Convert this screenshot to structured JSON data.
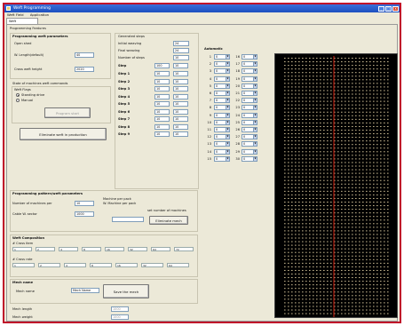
{
  "window": {
    "title": "Weft Programming",
    "minimize": "_",
    "maximize": "□",
    "close": "x"
  },
  "menu": [
    "Weft Field",
    "Application"
  ],
  "tabs": [
    "Weft Programming",
    "Programming Features"
  ],
  "section": {
    "title": "Programming Features"
  },
  "weft_params": {
    "title": "Programming weft parameters",
    "rows": [
      {
        "label": "Open shed",
        "value": ""
      },
      {
        "label": "W. Length(default)",
        "value": "40"
      },
      {
        "label": "Cross weft height",
        "value": "2020"
      }
    ]
  },
  "mode": {
    "title": "State of machines weft commands",
    "subtitle": "Weft Flags",
    "options": [
      {
        "label": "Standing drive",
        "selected": true
      },
      {
        "label": "Manual",
        "selected": false
      }
    ],
    "program_button": "Program start",
    "eliminate_button": "Eliminate weft in production"
  },
  "seq": {
    "title": "Generated steps",
    "rows": [
      {
        "label": "Initial weaving",
        "value": "24"
      },
      {
        "label": "Final weaving",
        "value": "24"
      },
      {
        "label": "Number of steps",
        "value": "10"
      }
    ],
    "header": [
      "Step",
      "100",
      "10"
    ],
    "steps": [
      {
        "label": "Step 1",
        "a": "10",
        "b": "10"
      },
      {
        "label": "Step 2",
        "a": "10",
        "b": "10"
      },
      {
        "label": "Step 3",
        "a": "10",
        "b": "10"
      },
      {
        "label": "Step 4",
        "a": "10",
        "b": "10"
      },
      {
        "label": "Step 5",
        "a": "10",
        "b": "10"
      },
      {
        "label": "Step 6",
        "a": "10",
        "b": "10"
      },
      {
        "label": "Step 7",
        "a": "10",
        "b": "10"
      },
      {
        "label": "Step 8",
        "a": "10",
        "b": "10"
      },
      {
        "label": "Step 9",
        "a": "10",
        "b": "10"
      }
    ]
  },
  "auto": {
    "title": "Automatic",
    "rows": [
      {
        "n1": "1",
        "v1": "0",
        "n2": "16",
        "v2": "0"
      },
      {
        "n1": "2",
        "v1": "0",
        "n2": "17",
        "v2": "0"
      },
      {
        "n1": "3",
        "v1": "0",
        "n2": "18",
        "v2": "0"
      },
      {
        "n1": "4",
        "v1": "0",
        "n2": "19",
        "v2": "0"
      },
      {
        "n1": "5",
        "v1": "0",
        "n2": "20",
        "v2": "0"
      },
      {
        "n1": "6",
        "v1": "0",
        "n2": "21",
        "v2": "0"
      },
      {
        "n1": "7",
        "v1": "0",
        "n2": "22",
        "v2": "0"
      },
      {
        "n1": "8",
        "v1": "0",
        "n2": "23",
        "v2": "0"
      },
      {
        "n1": "9",
        "v1": "0",
        "n2": "24",
        "v2": "0"
      },
      {
        "n1": "10",
        "v1": "0",
        "n2": "25",
        "v2": "0"
      },
      {
        "n1": "11",
        "v1": "0",
        "n2": "26",
        "v2": "0"
      },
      {
        "n1": "12",
        "v1": "0",
        "n2": "27",
        "v2": "0"
      },
      {
        "n1": "13",
        "v1": "0",
        "n2": "28",
        "v2": "0"
      },
      {
        "n1": "14",
        "v1": "0",
        "n2": "29",
        "v2": "0"
      },
      {
        "n1": "15",
        "v1": "0",
        "n2": "30",
        "v2": "0"
      }
    ]
  },
  "pattern": {
    "title": "Programming pattern/weft parameters",
    "rows": [
      {
        "label": "Number of machines per",
        "value": "10"
      },
      {
        "label": "Cable W. sector",
        "value": "1000"
      }
    ],
    "note1": "Machine per pack",
    "note2": "W. Machine per pack",
    "note3": "set number of machines",
    "eliminate_button": "Eliminate mech"
  },
  "composition": {
    "title": "Weft Composition",
    "row1_label": "# Cross item",
    "row1": [
      "1",
      "2",
      "4",
      "8",
      "16",
      "32",
      "64",
      "72"
    ],
    "row2_label": "# Cross rate",
    "row2": [
      "1",
      "2",
      "4",
      "8",
      "16",
      "32",
      "64"
    ]
  },
  "mech": {
    "title": "Mech name",
    "label": "Mech name",
    "value": "Mech Name",
    "save_button": "Save the mech"
  },
  "footer": [
    {
      "label": "Mech length",
      "value": "1000"
    },
    {
      "label": "Mech weight",
      "value": "1000"
    }
  ],
  "colors": {
    "accent": "#c0102a",
    "plot_bg": "#000000",
    "plot_dots": "#c8b890",
    "marker": "#d02010"
  }
}
